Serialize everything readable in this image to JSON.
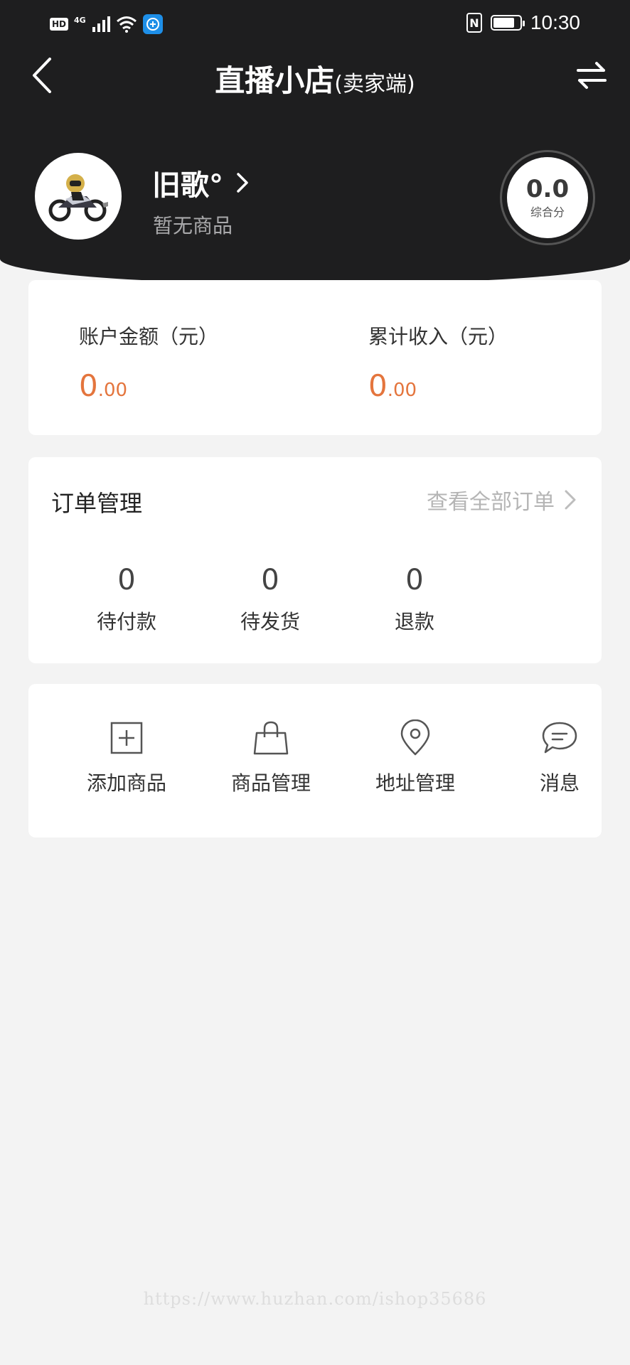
{
  "status_bar": {
    "hd": "HD",
    "network": "4G",
    "time": "10:30",
    "nfc": "N",
    "icons": [
      "signal-icon",
      "wifi-icon",
      "app-notification-icon",
      "nfc-icon",
      "battery-icon"
    ]
  },
  "nav": {
    "title": "直播小店",
    "subtitle": "(卖家端)",
    "back_icon": "chevron-left-icon",
    "switch_icon": "swap-arrows-icon"
  },
  "profile": {
    "name": "旧歌°",
    "subtitle": "暂无商品",
    "score_value": "0.0",
    "score_label": "综合分"
  },
  "balance": {
    "account_label": "账户金额（元）",
    "account_int": "0",
    "account_dec": ".00",
    "income_label": "累计收入（元）",
    "income_int": "0",
    "income_dec": ".00"
  },
  "orders": {
    "title": "订单管理",
    "view_all": "查看全部订单",
    "stats": [
      {
        "count": "0",
        "label": "待付款"
      },
      {
        "count": "0",
        "label": "待发货"
      },
      {
        "count": "0",
        "label": "退款"
      }
    ]
  },
  "tools": [
    {
      "label": "添加商品",
      "icon": "plus-square-icon"
    },
    {
      "label": "商品管理",
      "icon": "shopping-bag-icon"
    },
    {
      "label": "地址管理",
      "icon": "location-pin-icon"
    },
    {
      "label": "消息",
      "icon": "chat-bubble-icon"
    }
  ],
  "watermark": "https://www.huzhan.com/ishop35686",
  "colors": {
    "header_bg": "#1e1e1f",
    "accent_orange": "#e4753d",
    "page_bg": "#f3f3f3"
  }
}
